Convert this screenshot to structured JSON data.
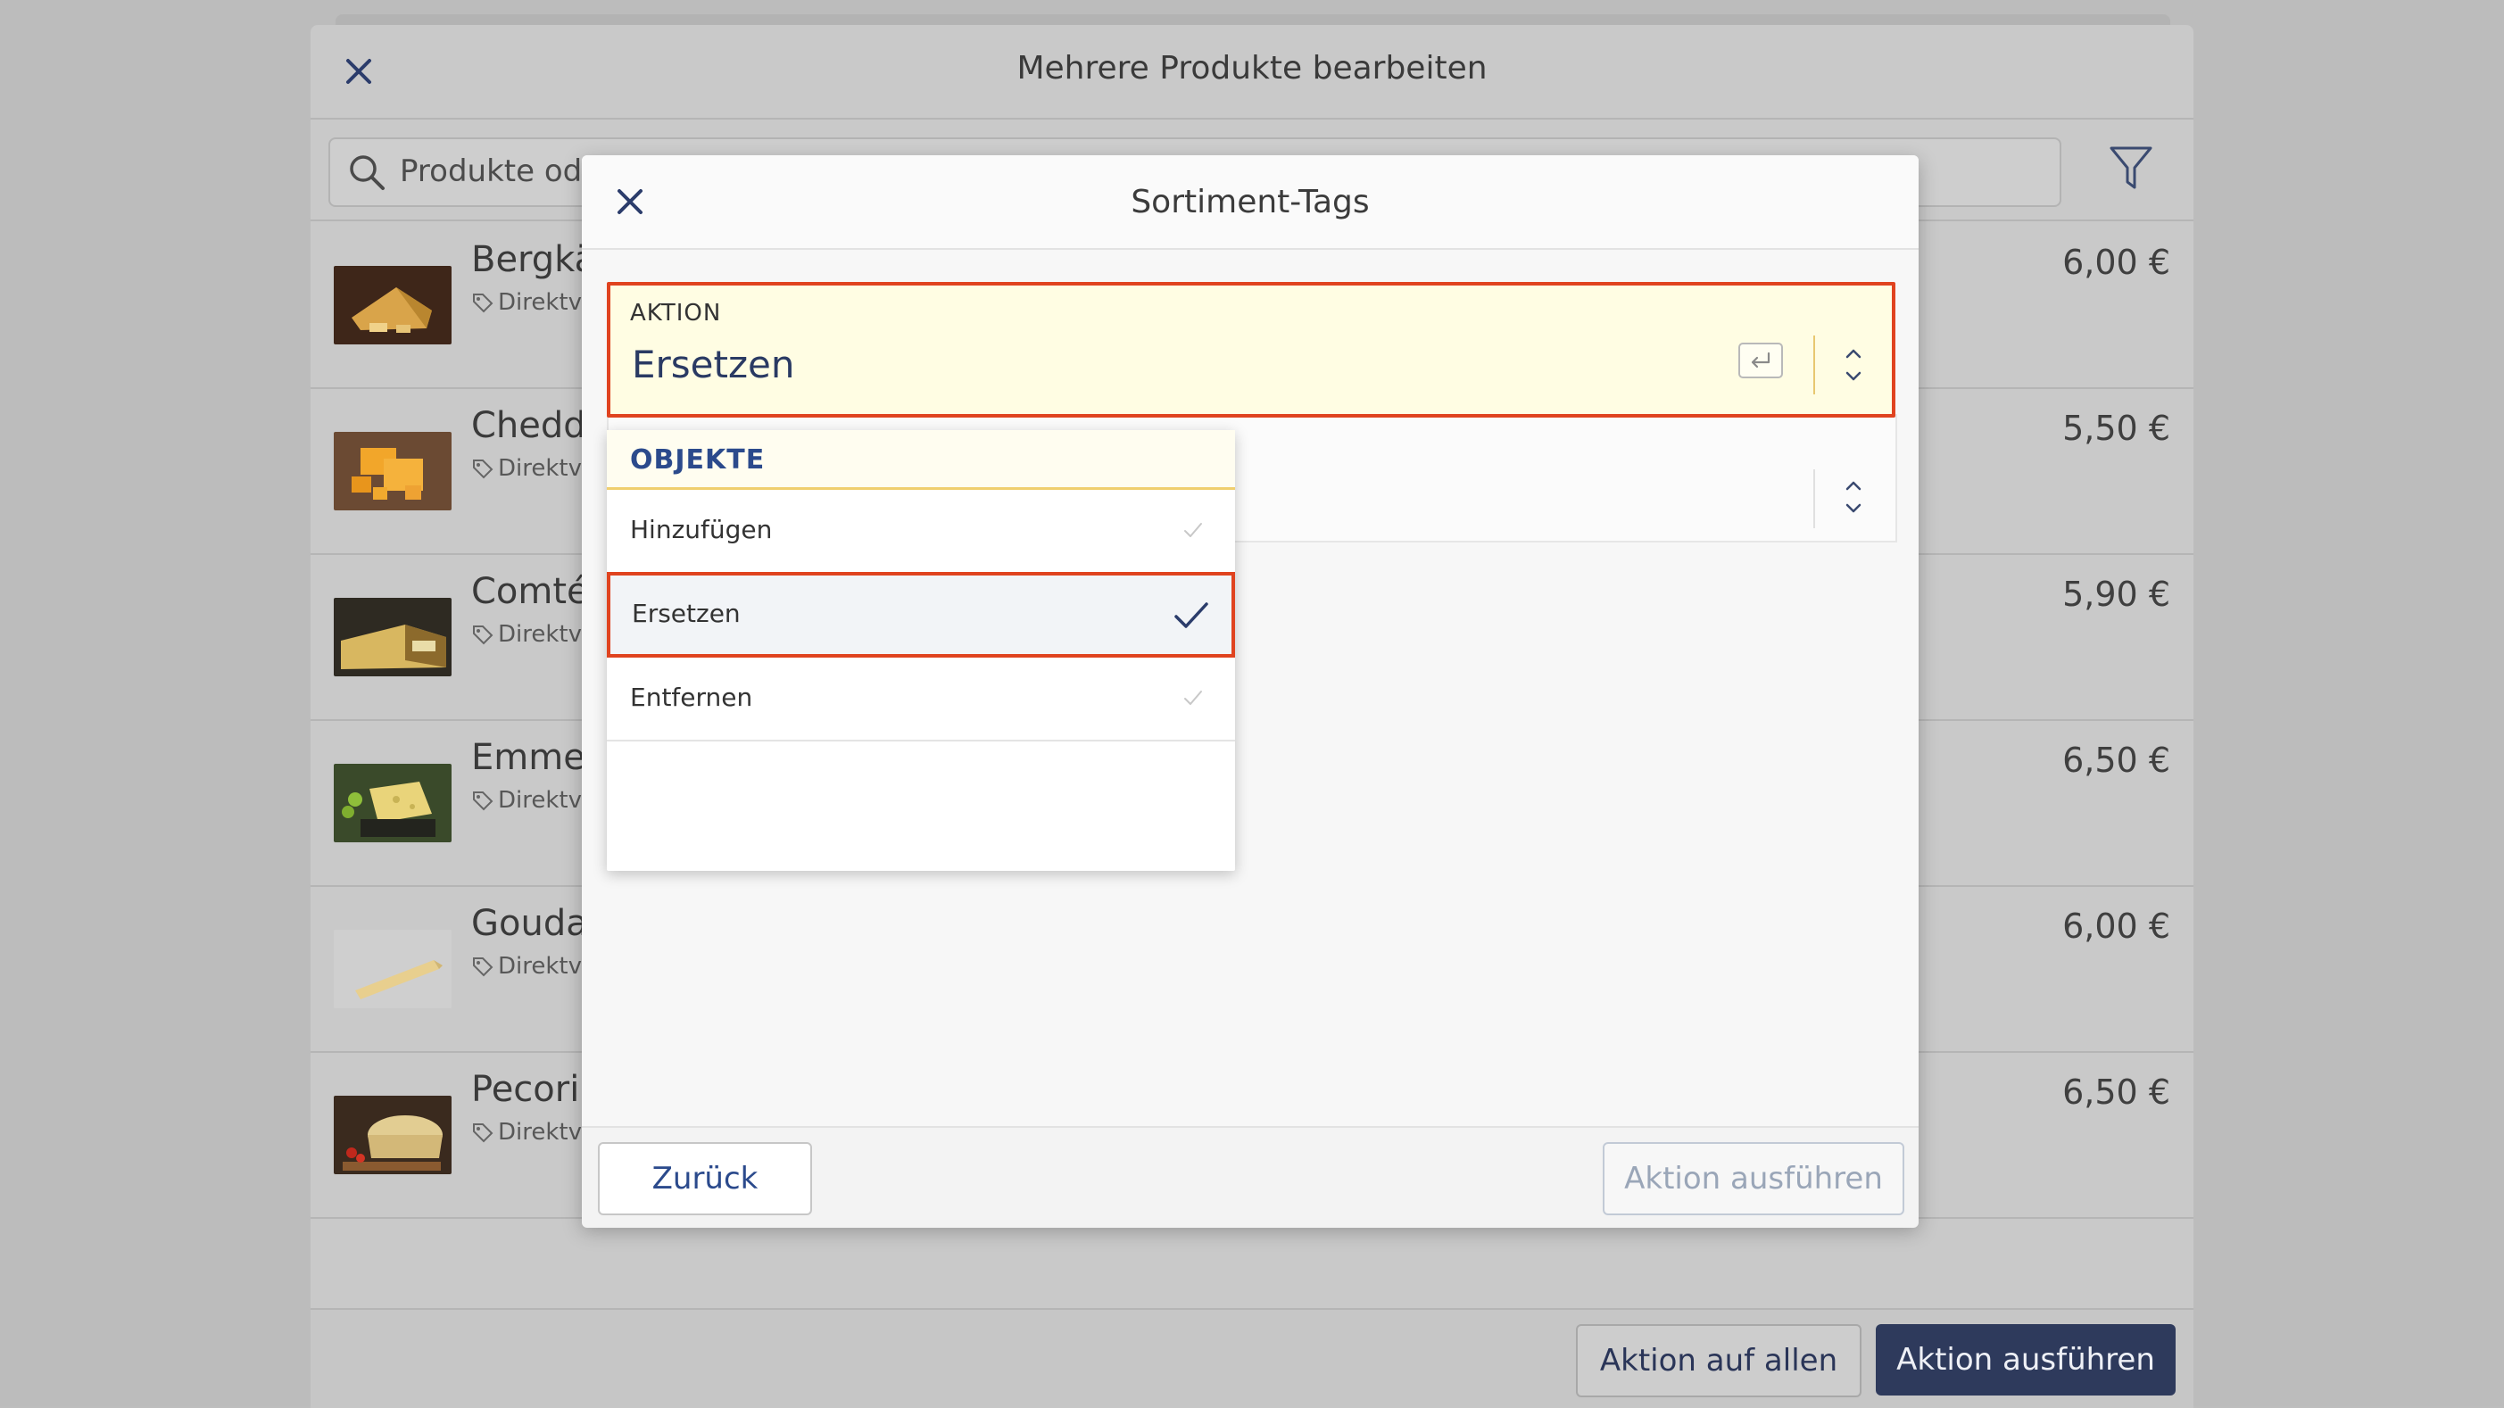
{
  "background_sheet": {
    "title": "Mehrere Produkte bearbeiten",
    "search_placeholder": "Produkte oder",
    "products": [
      {
        "name": "Bergkä",
        "subtitle": "Direktve",
        "price": "6,00 €"
      },
      {
        "name": "Chedda",
        "subtitle": "Direktve",
        "price": "5,50 €"
      },
      {
        "name": "Comté",
        "subtitle": "Direktve",
        "price": "5,90 €"
      },
      {
        "name": "Emmen",
        "subtitle": "Direktve",
        "price": "6,50 €"
      },
      {
        "name": "Gouda",
        "subtitle": "Direktve",
        "price": "6,00 €"
      },
      {
        "name": "Pecorir",
        "subtitle": "Direktve",
        "price": "6,50 €"
      }
    ],
    "footer": {
      "action_all_label": "Aktion auf allen",
      "execute_label": "Aktion ausführen"
    }
  },
  "modal": {
    "title": "Sortiment-Tags",
    "aktion_field": {
      "label": "AKTION",
      "value": "Ersetzen"
    },
    "dropdown": {
      "header": "OBJEKTE",
      "items": [
        {
          "label": "Hinzufügen",
          "selected": false
        },
        {
          "label": "Ersetzen",
          "selected": true
        },
        {
          "label": "Entfernen",
          "selected": false
        }
      ]
    },
    "footer": {
      "back_label": "Zurück",
      "execute_label": "Aktion ausführen"
    }
  },
  "colors": {
    "accent_navy": "#2e3a5c",
    "highlight_red": "#e0431f",
    "field_yellow": "#fffde3",
    "link_blue": "#2b4a8c"
  }
}
